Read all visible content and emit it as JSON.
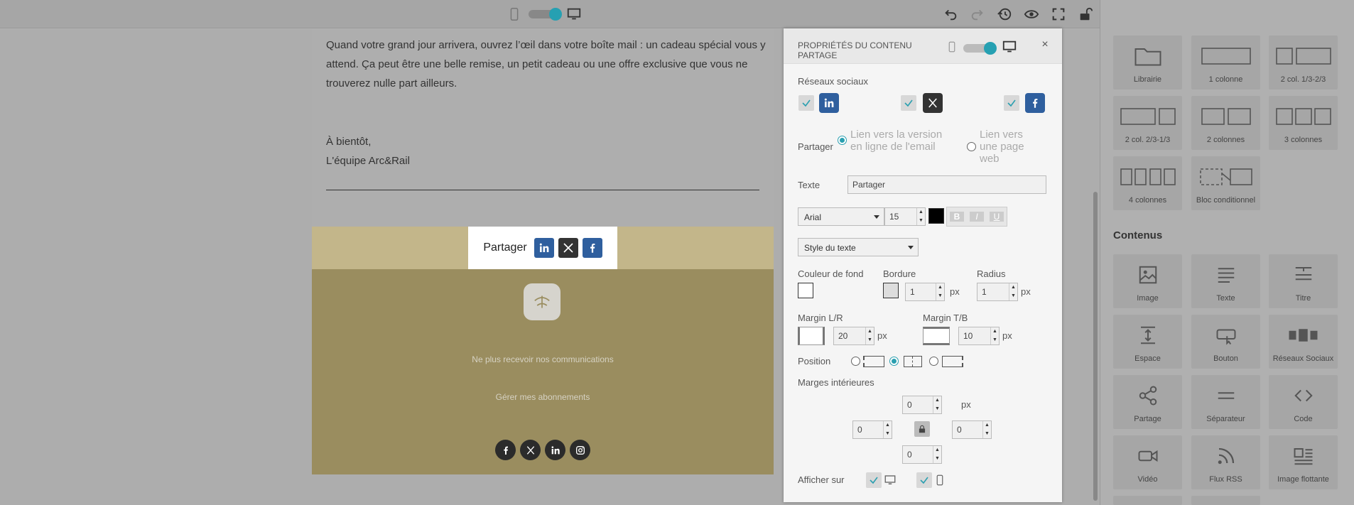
{
  "toolbar": {
    "icons": [
      "mobile-icon",
      "view-toggle",
      "desktop-icon",
      "undo-icon",
      "redo-icon",
      "history-icon",
      "preview-icon",
      "fullscreen-icon",
      "unlock-icon",
      "layers-icon"
    ]
  },
  "email": {
    "paragraph": "Quand votre grand jour arrivera, ouvrez l’œil dans votre boîte mail : un cadeau spécial vous y attend. Ça peut être une belle remise, un petit cadeau ou une offre exclusive que vous ne trouverez nulle part ailleurs.",
    "greeting": "À bientôt,",
    "signature": "L'équipe Arc&Rail",
    "share_label": "Partager",
    "footer_unsubscribe": "Ne plus recevoir nos communications",
    "footer_manage": "Gérer mes abonnements"
  },
  "panel": {
    "title": "PROPRIÉTÉS DU CONTENU PARTAGE",
    "close": "×",
    "social_label": "Réseaux sociaux",
    "share_label": "Partager",
    "option_online": "Lien vers la version en ligne de l'email",
    "option_web": "Lien vers une page web",
    "text_label": "Texte",
    "text_value": "Partager",
    "font": "Arial",
    "font_size": "15",
    "text_style": "Style du texte",
    "bg_label": "Couleur de fond",
    "border_label": "Bordure",
    "border_value": "1",
    "radius_label": "Radius",
    "radius_value": "1",
    "unit": "px",
    "margin_lr_label": "Margin L/R",
    "margin_lr_value": "20",
    "margin_tb_label": "Margin T/B",
    "margin_tb_value": "10",
    "position_label": "Position",
    "inner_label": "Marges intérieures",
    "pad_top": "0",
    "pad_left": "0",
    "pad_right": "0",
    "pad_bottom": "0",
    "show_on_label": "Afficher sur",
    "format_buttons": [
      "B",
      "I",
      "U"
    ]
  },
  "sidebar": {
    "layouts": [
      "Librairie",
      "1 colonne",
      "2 col. 1/3-2/3",
      "2 col. 2/3-1/3",
      "2 colonnes",
      "3 colonnes",
      "4 colonnes",
      "Bloc conditionnel"
    ],
    "contents_title": "Contenus",
    "contents": [
      "Image",
      "Texte",
      "Titre",
      "Espace",
      "Bouton",
      "Réseaux Sociaux",
      "Partage",
      "Séparateur",
      "Code",
      "Vidéo",
      "Flux RSS",
      "Image flottante"
    ]
  },
  "colors": {
    "accent": "#26a0b2",
    "linkedin": "#2f5f9e",
    "x": "#333333",
    "facebook": "#2f5f9e",
    "band": "#c3b68a",
    "footer": "#9a8d5f"
  }
}
